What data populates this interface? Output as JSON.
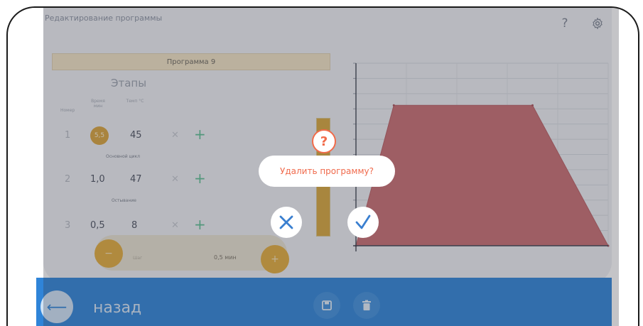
{
  "header": {
    "title": "Редактирование программы",
    "help_icon": "question-icon",
    "settings_icon": "gear-icon"
  },
  "program": {
    "name": "Программа 9"
  },
  "stages": {
    "title": "Этапы",
    "col_headers": [
      "Номер",
      "Время мин",
      "Темп °C"
    ],
    "rows": [
      {
        "num": "1",
        "time": "5,5",
        "temp": "45",
        "label_after": "Основной цикл"
      },
      {
        "num": "2",
        "time": "1,0",
        "temp": "47",
        "label_after": "Остывание"
      },
      {
        "num": "3",
        "time": "0,5",
        "temp": "8"
      }
    ]
  },
  "controls": {
    "minus_label": "−",
    "plus_label": "+",
    "field_label": "Шаг",
    "field_value": "0,5 мин"
  },
  "level": {
    "fill": 1.0
  },
  "chart_data": {
    "type": "area",
    "title": "",
    "xlabel": "",
    "ylabel": "",
    "x": [
      0,
      1.5,
      7,
      10
    ],
    "y": [
      0,
      50,
      50,
      0
    ],
    "xlim": [
      0,
      10
    ],
    "ylim": [
      0,
      65
    ],
    "grid": true,
    "color": "#c96d72"
  },
  "dialog": {
    "badge": "?",
    "message": "Удалить программу?",
    "cancel_icon": "close-icon",
    "confirm_icon": "checkmark-icon"
  },
  "footer": {
    "back_label": "назад",
    "save_icon": "save-icon",
    "delete_icon": "trash-icon"
  }
}
